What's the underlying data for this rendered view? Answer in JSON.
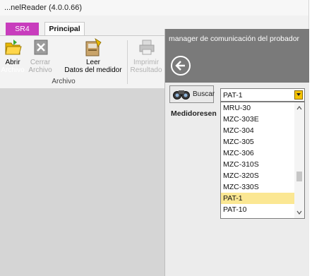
{
  "window": {
    "title": "...nelReader (4.0.0.66)"
  },
  "tabs": [
    {
      "label": "SR4"
    },
    {
      "label": "Principal"
    }
  ],
  "ribbon": {
    "buttons": [
      {
        "label_1": "Abrir",
        "label_2": "Archivo",
        "icon": "folder-open-icon"
      },
      {
        "label_1": "Cerrar",
        "label_2": "Archivo",
        "icon": "close-file-icon",
        "disabled": true
      },
      {
        "label_1": "Leer",
        "label_2": "Datos del medidor",
        "icon": "read-meter-icon"
      },
      {
        "label_1": "Imprimir",
        "label_2": "Resultado",
        "icon": "printer-icon",
        "disabled": true
      }
    ],
    "group_label": "Archivo"
  },
  "panel": {
    "title": "manager de comunicación del probador",
    "back_icon": "back-arrow-icon",
    "search_button": {
      "label": "Buscar",
      "icon": "binoculars-icon"
    },
    "combo_value": "PAT-1",
    "meters_label": "Medidoresen",
    "dropdown_items": [
      "MRU-30",
      "MZC-303E",
      "MZC-304",
      "MZC-305",
      "MZC-306",
      "MZC-310S",
      "MZC-320S",
      "MZC-330S",
      "PAT-1",
      "PAT-10"
    ],
    "selected_item": "PAT-1"
  },
  "colors": {
    "tab_sr4": "#c83dbd",
    "panel_header": "#7a7a7a",
    "selection": "#fbe793",
    "combo_button": "#f5c300"
  }
}
